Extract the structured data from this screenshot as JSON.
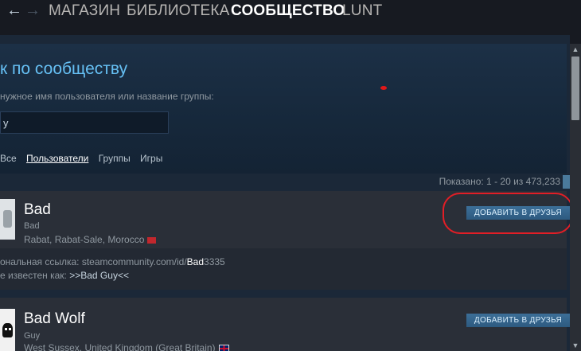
{
  "nav": {
    "back_icon": "←",
    "forward_icon": "→",
    "items": [
      "МАГАЗИН",
      "БИБЛИОТЕКА",
      "СООБЩЕСТВО",
      "LUNT"
    ],
    "active": "СООБЩЕСТВО"
  },
  "search": {
    "title": "к по сообществу",
    "hint": "нужное имя пользователя или название группы:",
    "input_value": "y",
    "tabs": [
      "Все",
      "Пользователи",
      "Группы",
      "Игры"
    ],
    "active_tab": "Пользователи"
  },
  "results_count": "Показано: 1 - 20 из 473,233",
  "results": [
    {
      "persona_name": "Bad",
      "real_name": "Bad",
      "location": "Rabat, Rabat-Sale, Morocco",
      "flag": "morocco-flag",
      "add_label": "ДОБАВИТЬ В ДРУЗЬЯ",
      "url_prefix": "ональная ссылка: steamcommunity.com/id/",
      "url_highlight": "Bad",
      "url_suffix": "3335",
      "also_known_prefix": "е известен как: ",
      "also_known_value": ">>Bad Guy<<"
    },
    {
      "persona_name": "Bad Wolf",
      "real_name": "Guy",
      "location": "West Sussex, United Kingdom (Great Britain)",
      "flag": "uk-flag",
      "add_label": "ДОБАВИТЬ В ДРУЗЬЯ"
    }
  ],
  "scroll": {
    "up_icon": "▲",
    "down_icon": "▼"
  },
  "colors": {
    "accent": "#66c0f4",
    "background": "#1b2838",
    "annotation": "#e21e26"
  }
}
